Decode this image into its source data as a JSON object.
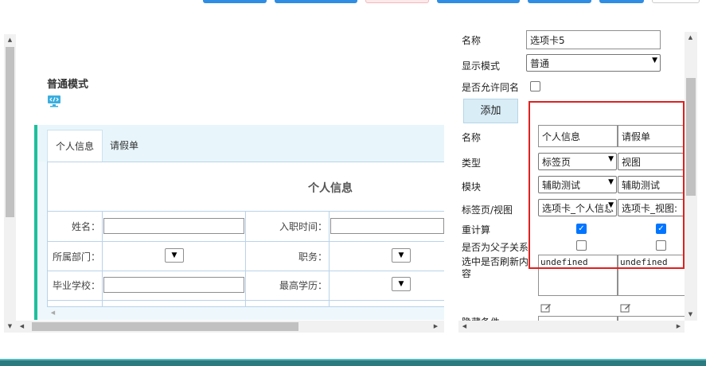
{
  "top_toolbar": {
    "buttons": [
      "",
      "",
      "",
      "",
      "",
      "",
      ""
    ]
  },
  "designer": {
    "mode_title": "普通模式",
    "icons": {
      "mode": "monitor-code-icon"
    },
    "tabs": [
      {
        "label": "个人信息",
        "active": true
      },
      {
        "label": "请假单",
        "active": false
      }
    ],
    "form_title": "个人信息",
    "fields": [
      {
        "label": "姓名：",
        "type": "text",
        "value": ""
      },
      {
        "label": "入职时间：",
        "type": "text",
        "value": ""
      },
      {
        "label": "所属部门：",
        "type": "select",
        "value": ""
      },
      {
        "label": "职务：",
        "type": "select",
        "value": ""
      },
      {
        "label": "毕业学校：",
        "type": "text",
        "value": ""
      },
      {
        "label": "最高学历：",
        "type": "select",
        "value": ""
      }
    ],
    "accent_color": "#1dbf9c"
  },
  "properties": {
    "name_label": "名称",
    "name_value": "选项卡5",
    "display_mode_label": "显示模式",
    "display_mode_value": "普通",
    "allow_same_name_label": "是否允许同名",
    "allow_same_name_checked": false,
    "add_button": "添加",
    "grid": {
      "row_labels": {
        "name": "名称",
        "type": "类型",
        "module": "模块",
        "tab_view": "标签页/视图",
        "recalc": "重计算",
        "parent_child": "是否为父子关系",
        "refresh_on_select": "选中是否刷新内容",
        "partial": "隐藏条件"
      },
      "columns": [
        {
          "name": "个人信息",
          "type": "标签页",
          "module": "辅助测试",
          "tab_view": "选项卡_个人信息",
          "recalc": true,
          "parent_child": false,
          "refresh": "undefined"
        },
        {
          "name": "请假单",
          "type": "视图",
          "module": "辅助测试",
          "tab_view": "选项卡_视图:",
          "recalc": true,
          "parent_child": false,
          "refresh": "undefined"
        }
      ]
    },
    "icons": {
      "edit": "edit-icon"
    },
    "highlight_color": "#e02020"
  }
}
